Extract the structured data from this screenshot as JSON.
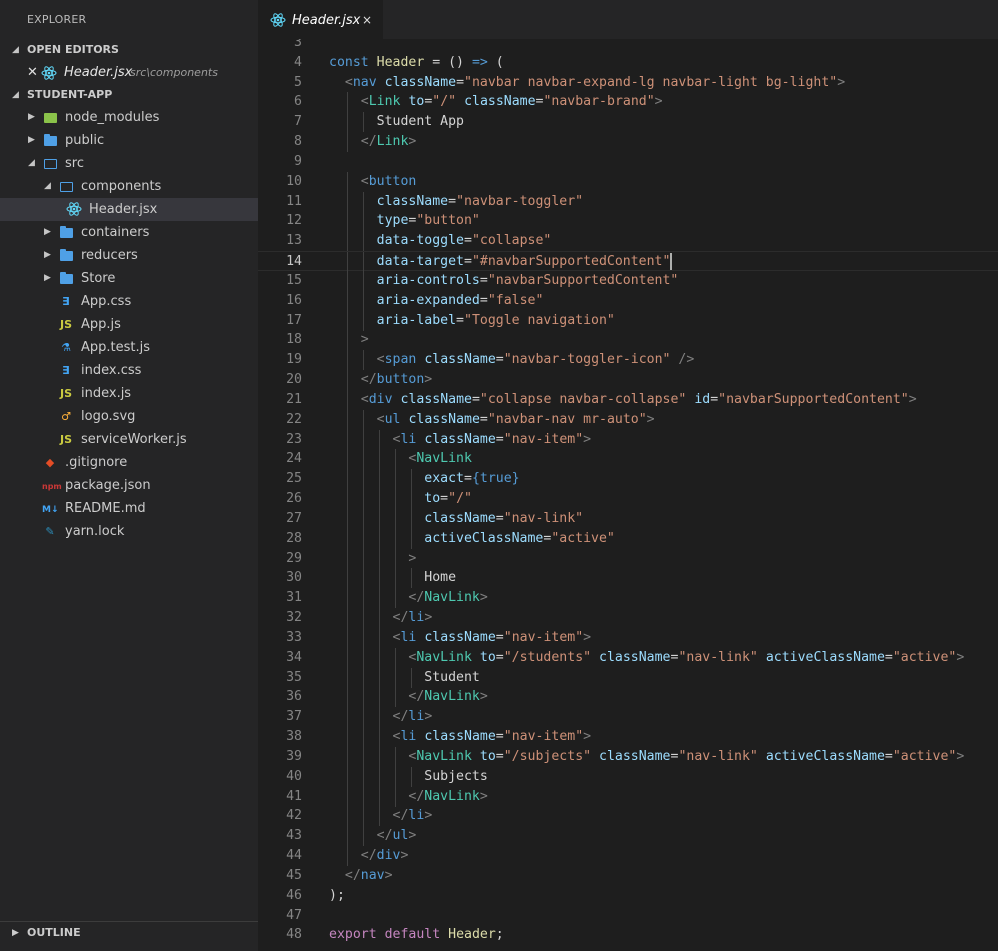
{
  "sidebar": {
    "explorer_title": "EXPLORER",
    "open_editors_label": "OPEN EDITORS",
    "open_editor": {
      "name": "Header.jsx",
      "path": "src\\components"
    },
    "project_label": "STUDENT-APP",
    "outline_label": "OUTLINE",
    "tree": [
      {
        "label": "node_modules",
        "icon": "node-modules-folder-icon",
        "depth": 1,
        "type": "folder",
        "expanded": false
      },
      {
        "label": "public",
        "icon": "folder-icon",
        "depth": 1,
        "type": "folder",
        "expanded": false
      },
      {
        "label": "src",
        "icon": "folder-open-icon",
        "depth": 1,
        "type": "folder",
        "expanded": true
      },
      {
        "label": "components",
        "icon": "folder-open-icon",
        "depth": 2,
        "type": "folder",
        "expanded": true
      },
      {
        "label": "Header.jsx",
        "icon": "react-icon",
        "depth": 3,
        "type": "file",
        "selected": true
      },
      {
        "label": "containers",
        "icon": "folder-icon",
        "depth": 2,
        "type": "folder",
        "expanded": false
      },
      {
        "label": "reducers",
        "icon": "folder-icon",
        "depth": 2,
        "type": "folder",
        "expanded": false
      },
      {
        "label": "Store",
        "icon": "folder-icon",
        "depth": 2,
        "type": "folder",
        "expanded": false
      },
      {
        "label": "App.css",
        "icon": "css-icon",
        "depth": 2,
        "type": "file"
      },
      {
        "label": "App.js",
        "icon": "js-icon",
        "depth": 2,
        "type": "file"
      },
      {
        "label": "App.test.js",
        "icon": "test-flask-icon",
        "depth": 2,
        "type": "file"
      },
      {
        "label": "index.css",
        "icon": "css-icon",
        "depth": 2,
        "type": "file"
      },
      {
        "label": "index.js",
        "icon": "js-icon",
        "depth": 2,
        "type": "file"
      },
      {
        "label": "logo.svg",
        "icon": "svg-icon",
        "depth": 2,
        "type": "file"
      },
      {
        "label": "serviceWorker.js",
        "icon": "js-icon",
        "depth": 2,
        "type": "file"
      },
      {
        "label": ".gitignore",
        "icon": "git-icon",
        "depth": 1,
        "type": "file"
      },
      {
        "label": "package.json",
        "icon": "npm-icon",
        "depth": 1,
        "type": "file"
      },
      {
        "label": "README.md",
        "icon": "markdown-icon",
        "depth": 1,
        "type": "file"
      },
      {
        "label": "yarn.lock",
        "icon": "yarn-icon",
        "depth": 1,
        "type": "file"
      }
    ]
  },
  "tab": {
    "name": "Header.jsx",
    "close": "×"
  },
  "editor": {
    "active_line": 14,
    "lines": [
      {
        "n": 3,
        "d": 0,
        "t": []
      },
      {
        "n": 4,
        "d": 0,
        "t": [
          [
            "kw",
            "const"
          ],
          [
            "txt",
            " "
          ],
          [
            "ident",
            "Header"
          ],
          [
            "txt",
            " = () "
          ],
          [
            "kw",
            "=>"
          ],
          [
            "txt",
            " ("
          ]
        ]
      },
      {
        "n": 5,
        "d": 1,
        "t": [
          [
            "punct",
            "<"
          ],
          [
            "kw",
            "nav"
          ],
          [
            "txt",
            " "
          ],
          [
            "attr",
            "className"
          ],
          [
            "txt",
            "="
          ],
          [
            "str",
            "\"navbar navbar-expand-lg navbar-light bg-light\""
          ],
          [
            "punct",
            ">"
          ]
        ]
      },
      {
        "n": 6,
        "d": 2,
        "t": [
          [
            "punct",
            "<"
          ],
          [
            "tag",
            "Link"
          ],
          [
            "txt",
            " "
          ],
          [
            "attr",
            "to"
          ],
          [
            "txt",
            "="
          ],
          [
            "str",
            "\"/\""
          ],
          [
            "txt",
            " "
          ],
          [
            "attr",
            "className"
          ],
          [
            "txt",
            "="
          ],
          [
            "str",
            "\"navbar-brand\""
          ],
          [
            "punct",
            ">"
          ]
        ]
      },
      {
        "n": 7,
        "d": 3,
        "t": [
          [
            "txt",
            "Student App"
          ]
        ]
      },
      {
        "n": 8,
        "d": 2,
        "t": [
          [
            "punct",
            "</"
          ],
          [
            "tag",
            "Link"
          ],
          [
            "punct",
            ">"
          ]
        ]
      },
      {
        "n": 9,
        "d": 0,
        "t": []
      },
      {
        "n": 10,
        "d": 2,
        "t": [
          [
            "punct",
            "<"
          ],
          [
            "kw",
            "button"
          ]
        ]
      },
      {
        "n": 11,
        "d": 3,
        "t": [
          [
            "attr",
            "className"
          ],
          [
            "txt",
            "="
          ],
          [
            "str",
            "\"navbar-toggler\""
          ]
        ]
      },
      {
        "n": 12,
        "d": 3,
        "t": [
          [
            "attr",
            "type"
          ],
          [
            "txt",
            "="
          ],
          [
            "str",
            "\"button\""
          ]
        ]
      },
      {
        "n": 13,
        "d": 3,
        "t": [
          [
            "attr",
            "data-toggle"
          ],
          [
            "txt",
            "="
          ],
          [
            "str",
            "\"collapse\""
          ]
        ]
      },
      {
        "n": 14,
        "d": 3,
        "t": [
          [
            "attr",
            "data-target"
          ],
          [
            "txt",
            "="
          ],
          [
            "str",
            "\"#navbarSupportedContent\""
          ]
        ],
        "cursor": true
      },
      {
        "n": 15,
        "d": 3,
        "t": [
          [
            "attr",
            "aria-controls"
          ],
          [
            "txt",
            "="
          ],
          [
            "str",
            "\"navbarSupportedContent\""
          ]
        ]
      },
      {
        "n": 16,
        "d": 3,
        "t": [
          [
            "attr",
            "aria-expanded"
          ],
          [
            "txt",
            "="
          ],
          [
            "str",
            "\"false\""
          ]
        ]
      },
      {
        "n": 17,
        "d": 3,
        "t": [
          [
            "attr",
            "aria-label"
          ],
          [
            "txt",
            "="
          ],
          [
            "str",
            "\"Toggle navigation\""
          ]
        ]
      },
      {
        "n": 18,
        "d": 2,
        "t": [
          [
            "punct",
            ">"
          ]
        ]
      },
      {
        "n": 19,
        "d": 3,
        "t": [
          [
            "punct",
            "<"
          ],
          [
            "kw",
            "span"
          ],
          [
            "txt",
            " "
          ],
          [
            "attr",
            "className"
          ],
          [
            "txt",
            "="
          ],
          [
            "str",
            "\"navbar-toggler-icon\""
          ],
          [
            "txt",
            " "
          ],
          [
            "punct",
            "/>"
          ]
        ]
      },
      {
        "n": 20,
        "d": 2,
        "t": [
          [
            "punct",
            "</"
          ],
          [
            "kw",
            "button"
          ],
          [
            "punct",
            ">"
          ]
        ]
      },
      {
        "n": 21,
        "d": 2,
        "t": [
          [
            "punct",
            "<"
          ],
          [
            "kw",
            "div"
          ],
          [
            "txt",
            " "
          ],
          [
            "attr",
            "className"
          ],
          [
            "txt",
            "="
          ],
          [
            "str",
            "\"collapse navbar-collapse\""
          ],
          [
            "txt",
            " "
          ],
          [
            "attr",
            "id"
          ],
          [
            "txt",
            "="
          ],
          [
            "str",
            "\"navbarSupportedContent\""
          ],
          [
            "punct",
            ">"
          ]
        ]
      },
      {
        "n": 22,
        "d": 3,
        "t": [
          [
            "punct",
            "<"
          ],
          [
            "kw",
            "ul"
          ],
          [
            "txt",
            " "
          ],
          [
            "attr",
            "className"
          ],
          [
            "txt",
            "="
          ],
          [
            "str",
            "\"navbar-nav mr-auto\""
          ],
          [
            "punct",
            ">"
          ]
        ]
      },
      {
        "n": 23,
        "d": 4,
        "t": [
          [
            "punct",
            "<"
          ],
          [
            "kw",
            "li"
          ],
          [
            "txt",
            " "
          ],
          [
            "attr",
            "className"
          ],
          [
            "txt",
            "="
          ],
          [
            "str",
            "\"nav-item\""
          ],
          [
            "punct",
            ">"
          ]
        ]
      },
      {
        "n": 24,
        "d": 5,
        "t": [
          [
            "punct",
            "<"
          ],
          [
            "tag",
            "NavLink"
          ]
        ]
      },
      {
        "n": 25,
        "d": 6,
        "t": [
          [
            "attr",
            "exact"
          ],
          [
            "txt",
            "="
          ],
          [
            "bool",
            "{true}"
          ]
        ]
      },
      {
        "n": 26,
        "d": 6,
        "t": [
          [
            "attr",
            "to"
          ],
          [
            "txt",
            "="
          ],
          [
            "str",
            "\"/\""
          ]
        ]
      },
      {
        "n": 27,
        "d": 6,
        "t": [
          [
            "attr",
            "className"
          ],
          [
            "txt",
            "="
          ],
          [
            "str",
            "\"nav-link\""
          ]
        ]
      },
      {
        "n": 28,
        "d": 6,
        "t": [
          [
            "attr",
            "activeClassName"
          ],
          [
            "txt",
            "="
          ],
          [
            "str",
            "\"active\""
          ]
        ]
      },
      {
        "n": 29,
        "d": 5,
        "t": [
          [
            "punct",
            ">"
          ]
        ]
      },
      {
        "n": 30,
        "d": 6,
        "t": [
          [
            "txt",
            "Home"
          ]
        ]
      },
      {
        "n": 31,
        "d": 5,
        "t": [
          [
            "punct",
            "</"
          ],
          [
            "tag",
            "NavLink"
          ],
          [
            "punct",
            ">"
          ]
        ]
      },
      {
        "n": 32,
        "d": 4,
        "t": [
          [
            "punct",
            "</"
          ],
          [
            "kw",
            "li"
          ],
          [
            "punct",
            ">"
          ]
        ]
      },
      {
        "n": 33,
        "d": 4,
        "t": [
          [
            "punct",
            "<"
          ],
          [
            "kw",
            "li"
          ],
          [
            "txt",
            " "
          ],
          [
            "attr",
            "className"
          ],
          [
            "txt",
            "="
          ],
          [
            "str",
            "\"nav-item\""
          ],
          [
            "punct",
            ">"
          ]
        ]
      },
      {
        "n": 34,
        "d": 5,
        "t": [
          [
            "punct",
            "<"
          ],
          [
            "tag",
            "NavLink"
          ],
          [
            "txt",
            " "
          ],
          [
            "attr",
            "to"
          ],
          [
            "txt",
            "="
          ],
          [
            "str",
            "\"/students\""
          ],
          [
            "txt",
            " "
          ],
          [
            "attr",
            "className"
          ],
          [
            "txt",
            "="
          ],
          [
            "str",
            "\"nav-link\""
          ],
          [
            "txt",
            " "
          ],
          [
            "attr",
            "activeClassName"
          ],
          [
            "txt",
            "="
          ],
          [
            "str",
            "\"active\""
          ],
          [
            "punct",
            ">"
          ]
        ]
      },
      {
        "n": 35,
        "d": 6,
        "t": [
          [
            "txt",
            "Student"
          ]
        ]
      },
      {
        "n": 36,
        "d": 5,
        "t": [
          [
            "punct",
            "</"
          ],
          [
            "tag",
            "NavLink"
          ],
          [
            "punct",
            ">"
          ]
        ]
      },
      {
        "n": 37,
        "d": 4,
        "t": [
          [
            "punct",
            "</"
          ],
          [
            "kw",
            "li"
          ],
          [
            "punct",
            ">"
          ]
        ]
      },
      {
        "n": 38,
        "d": 4,
        "t": [
          [
            "punct",
            "<"
          ],
          [
            "kw",
            "li"
          ],
          [
            "txt",
            " "
          ],
          [
            "attr",
            "className"
          ],
          [
            "txt",
            "="
          ],
          [
            "str",
            "\"nav-item\""
          ],
          [
            "punct",
            ">"
          ]
        ]
      },
      {
        "n": 39,
        "d": 5,
        "t": [
          [
            "punct",
            "<"
          ],
          [
            "tag",
            "NavLink"
          ],
          [
            "txt",
            " "
          ],
          [
            "attr",
            "to"
          ],
          [
            "txt",
            "="
          ],
          [
            "str",
            "\"/subjects\""
          ],
          [
            "txt",
            " "
          ],
          [
            "attr",
            "className"
          ],
          [
            "txt",
            "="
          ],
          [
            "str",
            "\"nav-link\""
          ],
          [
            "txt",
            " "
          ],
          [
            "attr",
            "activeClassName"
          ],
          [
            "txt",
            "="
          ],
          [
            "str",
            "\"active\""
          ],
          [
            "punct",
            ">"
          ]
        ]
      },
      {
        "n": 40,
        "d": 6,
        "t": [
          [
            "txt",
            "Subjects"
          ]
        ]
      },
      {
        "n": 41,
        "d": 5,
        "t": [
          [
            "punct",
            "</"
          ],
          [
            "tag",
            "NavLink"
          ],
          [
            "punct",
            ">"
          ]
        ]
      },
      {
        "n": 42,
        "d": 4,
        "t": [
          [
            "punct",
            "</"
          ],
          [
            "kw",
            "li"
          ],
          [
            "punct",
            ">"
          ]
        ]
      },
      {
        "n": 43,
        "d": 3,
        "t": [
          [
            "punct",
            "</"
          ],
          [
            "kw",
            "ul"
          ],
          [
            "punct",
            ">"
          ]
        ]
      },
      {
        "n": 44,
        "d": 2,
        "t": [
          [
            "punct",
            "</"
          ],
          [
            "kw",
            "div"
          ],
          [
            "punct",
            ">"
          ]
        ]
      },
      {
        "n": 45,
        "d": 1,
        "t": [
          [
            "punct",
            "</"
          ],
          [
            "kw",
            "nav"
          ],
          [
            "punct",
            ">"
          ]
        ]
      },
      {
        "n": 46,
        "d": 0,
        "t": [
          [
            "txt",
            ");"
          ]
        ]
      },
      {
        "n": 47,
        "d": 0,
        "t": []
      },
      {
        "n": 48,
        "d": 0,
        "t": [
          [
            "kw2",
            "export"
          ],
          [
            "txt",
            " "
          ],
          [
            "kw2",
            "default"
          ],
          [
            "txt",
            " "
          ],
          [
            "ident",
            "Header"
          ],
          [
            "txt",
            ";"
          ]
        ]
      }
    ]
  }
}
